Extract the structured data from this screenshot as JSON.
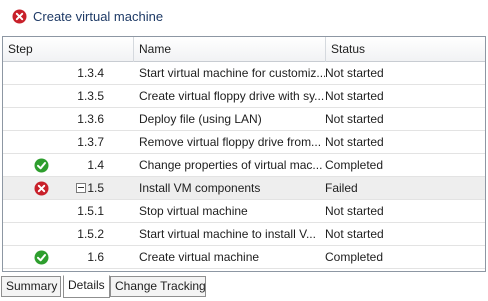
{
  "window": {
    "title": "Create virtual machine",
    "status_icon": "error-icon"
  },
  "grid": {
    "columns": {
      "step": "Step",
      "name": "Name",
      "status": "Status"
    },
    "rows": [
      {
        "step": "1.3.4",
        "name": "Start virtual machine for customiz...",
        "status": "Not started",
        "icon": "",
        "expander": false,
        "failed": false
      },
      {
        "step": "1.3.5",
        "name": "Create virtual floppy drive with sy...",
        "status": "Not started",
        "icon": "",
        "expander": false,
        "failed": false
      },
      {
        "step": "1.3.6",
        "name": "Deploy file (using LAN)",
        "status": "Not started",
        "icon": "",
        "expander": false,
        "failed": false
      },
      {
        "step": "1.3.7",
        "name": "Remove virtual floppy drive from...",
        "status": "Not started",
        "icon": "",
        "expander": false,
        "failed": false
      },
      {
        "step": "1.4",
        "name": "Change properties of virtual mac...",
        "status": "Completed",
        "icon": "checkmark-icon",
        "expander": false,
        "failed": false
      },
      {
        "step": "1.5",
        "name": "Install VM components",
        "status": "Failed",
        "icon": "error-icon",
        "expander": true,
        "failed": true
      },
      {
        "step": "1.5.1",
        "name": "Stop virtual machine",
        "status": "Not started",
        "icon": "",
        "expander": false,
        "failed": false
      },
      {
        "step": "1.5.2",
        "name": "Start virtual machine to install V...",
        "status": "Not started",
        "icon": "",
        "expander": false,
        "failed": false
      },
      {
        "step": "1.6",
        "name": "Create virtual machine",
        "status": "Completed",
        "icon": "checkmark-icon",
        "expander": false,
        "failed": false
      }
    ]
  },
  "tabs": [
    {
      "label": "Summary",
      "selected": false
    },
    {
      "label": "Details",
      "selected": true
    },
    {
      "label": "Change Tracking",
      "selected": false
    }
  ],
  "colors": {
    "success": "#2e9e2e",
    "error": "#c8202a",
    "failed_row": "#eeeeee",
    "title": "#1e3a66"
  }
}
